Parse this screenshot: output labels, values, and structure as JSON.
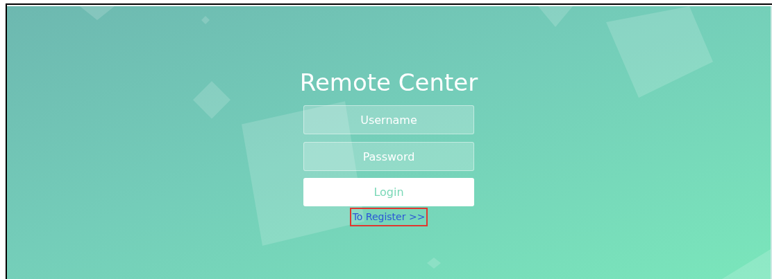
{
  "title": "Remote Center",
  "fields": [
    {
      "placeholder": "Username"
    },
    {
      "placeholder": "Password"
    }
  ],
  "login_button": {
    "label": "Login"
  },
  "register_link": {
    "label": "To Register >>",
    "highlighted": true
  }
}
